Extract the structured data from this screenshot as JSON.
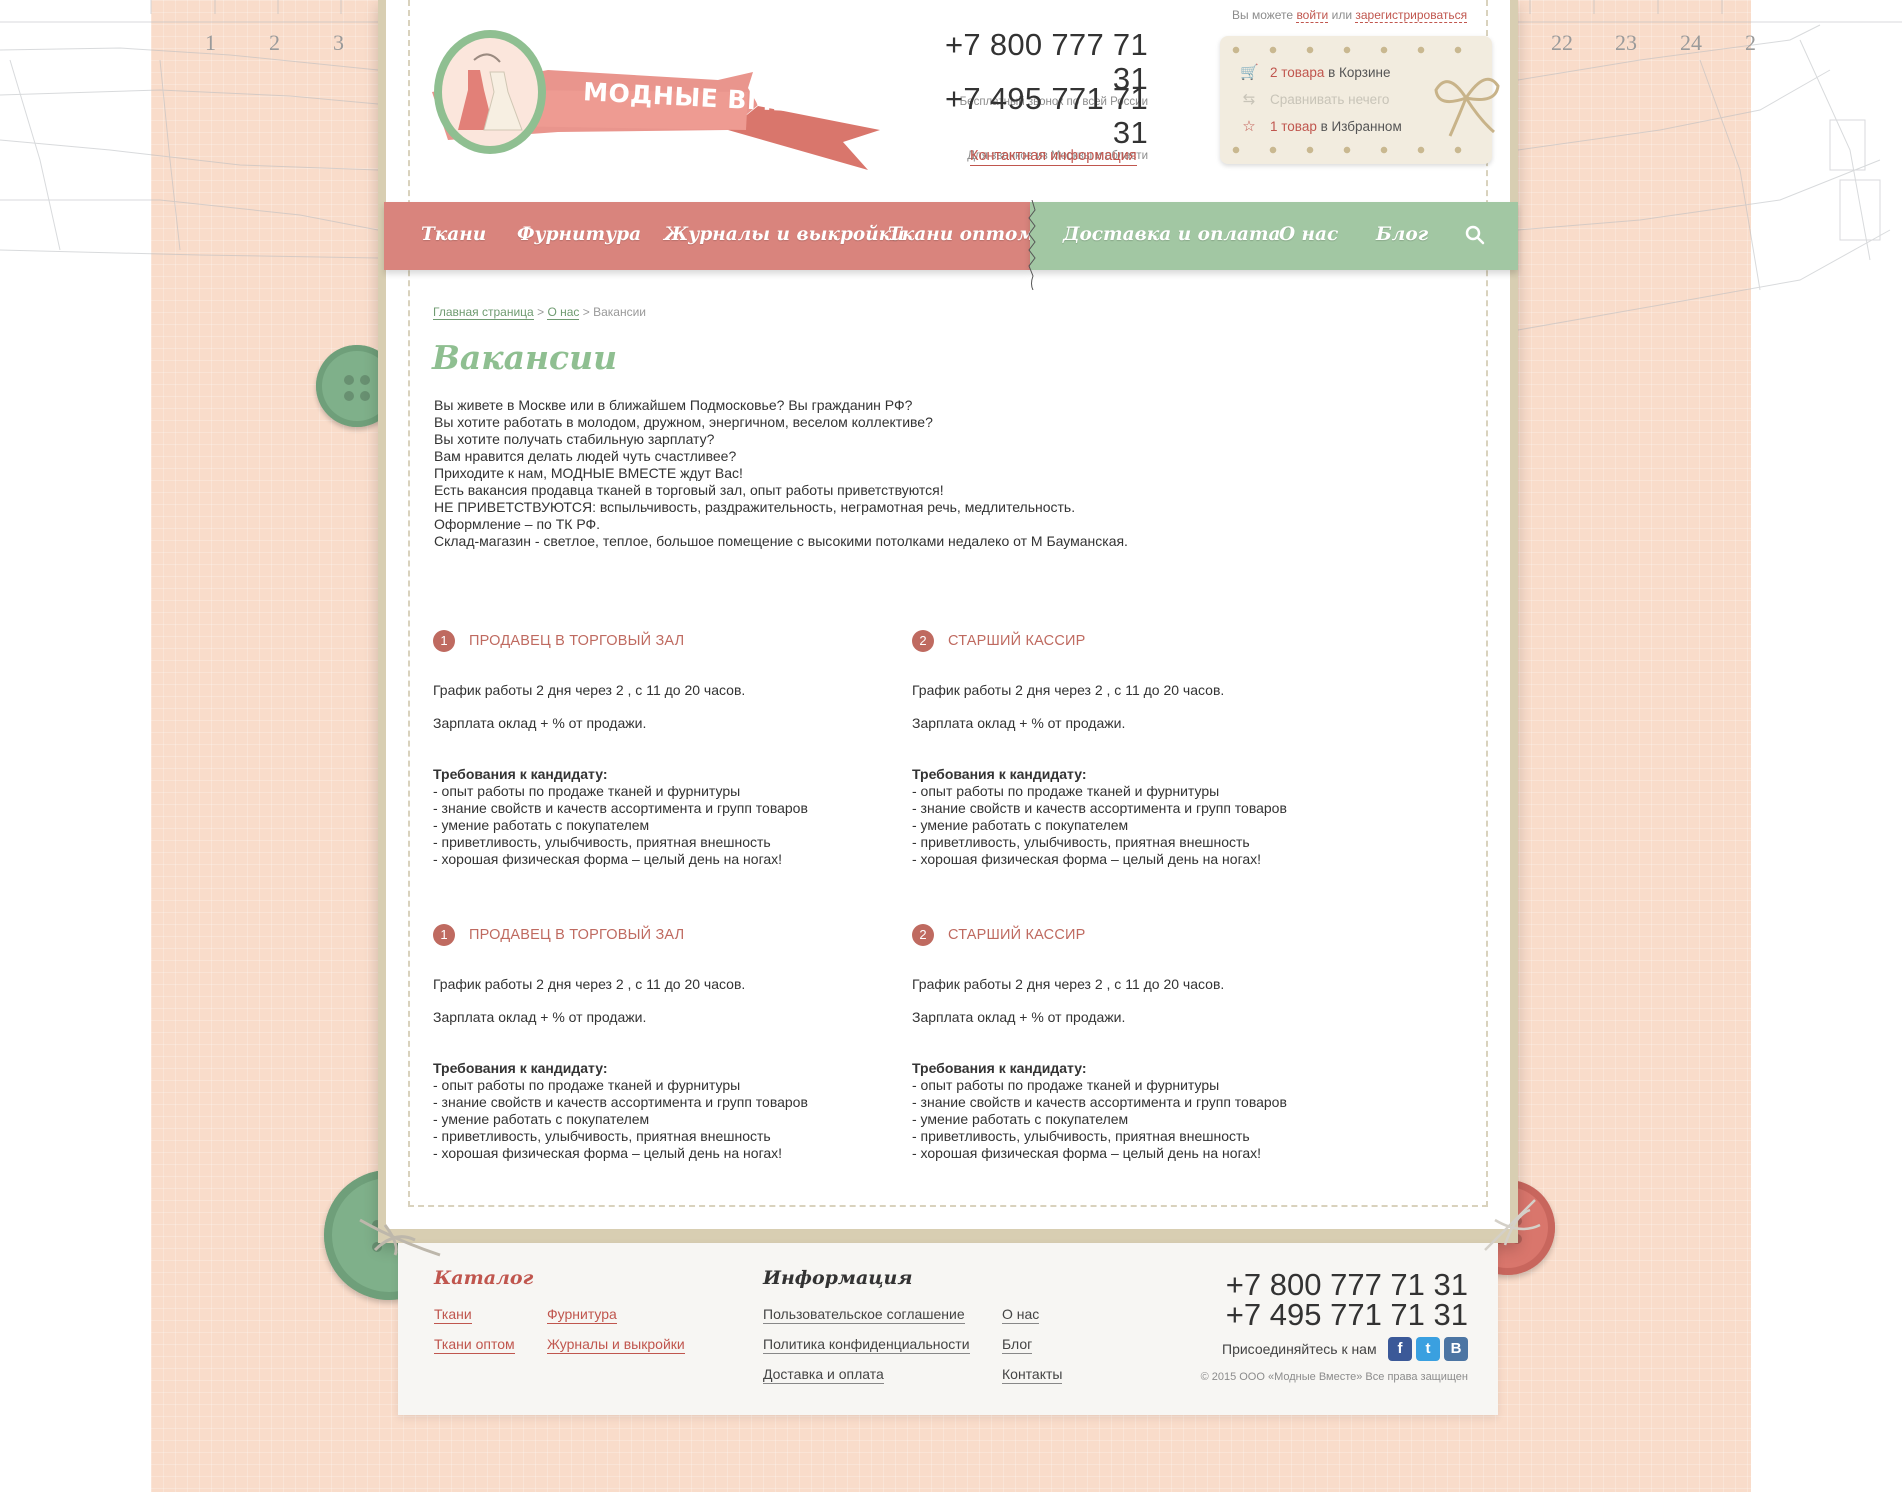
{
  "header": {
    "logo_text": "МОДНЫЕ ВМЕСТЕ",
    "phone1": "+7 800 777 71 31",
    "phone1_note": "Бесплатный звонок по всей России",
    "phone2": "+7 495 771 71 31",
    "phone2_note": "Для звонков из Москвы и области",
    "contact_link": "Контактная информация",
    "auth_prefix": "Вы можете",
    "login": "войти",
    "auth_or": "или",
    "register": "зарегистрироваться"
  },
  "cart": {
    "cart_count": "2 товара",
    "cart_suffix": "в Корзине",
    "compare": "Сравнивать нечего",
    "fav_count": "1 товар",
    "fav_suffix": "в Избранном"
  },
  "nav": {
    "left": [
      "Ткани",
      "Фурнитура",
      "Журналы и выкройки",
      "Ткани оптом"
    ],
    "right": [
      "Доставка и оплата",
      "О нас",
      "Блог"
    ]
  },
  "breadcrumb": {
    "home": "Главная страница",
    "sep1": ">",
    "about": "О нас",
    "sep2": ">",
    "current": "Вакансии"
  },
  "page": {
    "title": "Вакансии",
    "intro": [
      "Вы живете в Москве или в ближайшем Подмосковье? Вы гражданин РФ?",
      "Вы хотите работать в молодом, дружном, энергичном, веселом коллективе?",
      "Вы хотите получать стабильную зарплату?",
      "Вам нравится делать людей чуть счастливее?",
      "Приходите к нам, МОДНЫЕ ВМЕСТЕ ждут Вас!",
      "Есть вакансия продавца тканей в торговый зал, опыт работы приветствуются!",
      "НЕ ПРИВЕТСТВУЮТСЯ: вспыльчивость, раздражительность, неграмотная речь, медлительность.",
      "Оформление – по ТК РФ.",
      "Склад-магазин - светлое, теплое, большое помещение с высокими потолками недалеко от М Бауманская."
    ]
  },
  "vacancies": [
    {
      "num": "1",
      "title": "ПРОДАВЕЦ В ТОРГОВЫЙ ЗАЛ",
      "schedule": "График работы 2 дня через 2 , с 11 до 20 часов.",
      "salary": "Зарплата оклад + % от продажи.",
      "req_title": "Требования к кандидату:",
      "reqs": [
        "- опыт работы по продаже тканей и фурнитуры",
        "- знание свойств и качеств ассортимента и групп товаров",
        "- умение работать с покупателем",
        "- приветливость, улыбчивость, приятная внешность",
        "- хорошая физическая форма – целый день на ногах!"
      ]
    },
    {
      "num": "2",
      "title": "СТАРШИЙ КАССИР",
      "schedule": "График работы 2 дня через 2 , с 11 до 20 часов.",
      "salary": "Зарплата оклад + % от продажи.",
      "req_title": "Требования к кандидату:",
      "reqs": [
        "- опыт работы по продаже тканей и фурнитуры",
        "- знание свойств и качеств ассортимента и групп товаров",
        "- умение работать с покупателем",
        "- приветливость, улыбчивость, приятная внешность",
        "- хорошая физическая форма – целый день на ногах!"
      ]
    },
    {
      "num": "1",
      "title": "ПРОДАВЕЦ В ТОРГОВЫЙ ЗАЛ",
      "schedule": "График работы 2 дня через 2 , с 11 до 20 часов.",
      "salary": "Зарплата оклад + % от продажи.",
      "req_title": "Требования к кандидату:",
      "reqs": [
        "- опыт работы по продаже тканей и фурнитуры",
        "- знание свойств и качеств ассортимента и групп товаров",
        "- умение работать с покупателем",
        "- приветливость, улыбчивость, приятная внешность",
        "- хорошая физическая форма – целый день на ногах!"
      ]
    },
    {
      "num": "2",
      "title": "СТАРШИЙ КАССИР",
      "schedule": "График работы 2 дня через 2 , с 11 до 20 часов.",
      "salary": "Зарплата оклад + % от продажи.",
      "req_title": "Требования к кандидату:",
      "reqs": [
        "- опыт работы по продаже тканей и фурнитуры",
        "- знание свойств и качеств ассортимента и групп товаров",
        "- умение работать с покупателем",
        "- приветливость, улыбчивость, приятная внешность",
        "- хорошая физическая форма – целый день на ногах!"
      ]
    }
  ],
  "footer": {
    "catalog_title": "Каталог",
    "catalog_links": [
      "Ткани",
      "Фурнитура",
      "Ткани оптом",
      "Журналы и выкройки"
    ],
    "info_title": "Информация",
    "info_links": [
      "Пользовательское соглашение",
      "Политика конфиденциальности",
      "Доставка и оплата"
    ],
    "info_links2": [
      "О нас",
      "Блог",
      "Контакты"
    ],
    "phone1": "+7 800 777 71 31",
    "phone2": "+7 495 771 71 31",
    "join": "Присоединяйтесь к нам",
    "social": [
      "f",
      "t",
      "B"
    ],
    "copyright": "© 2015 ООО «Модные Вместе» Все права защищен"
  },
  "ruler": {
    "left": [
      "1",
      "2",
      "3"
    ],
    "right": [
      "22",
      "23",
      "24",
      "2"
    ]
  },
  "colors": {
    "accent_red": "#c0564e",
    "nav_red": "#d9847d",
    "nav_green": "#a2c7a3",
    "title_green": "#8fbf91",
    "background_peach": "#f9dcca"
  },
  "icons": {
    "cart": "cart-icon",
    "compare": "compare-icon",
    "favorite": "star-icon",
    "search": "search-icon"
  }
}
